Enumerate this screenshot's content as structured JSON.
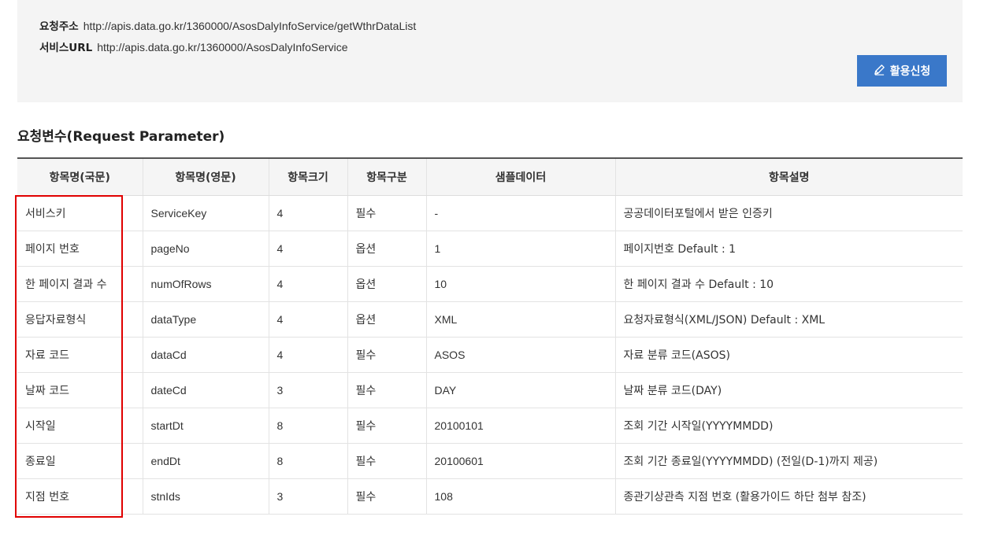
{
  "info": {
    "request_address_label": "요청주소",
    "request_address": "http://apis.data.go.kr/1360000/AsosDalyInfoService/getWthrDataList",
    "service_url_label": "서비스URL",
    "service_url": "http://apis.data.go.kr/1360000/AsosDalyInfoService",
    "apply_button": "활용신청"
  },
  "section_title": "요청변수(Request Parameter)",
  "table": {
    "headers": [
      "항목명(국문)",
      "항목명(영문)",
      "항목크기",
      "항목구분",
      "샘플데이터",
      "항목설명"
    ],
    "rows": [
      [
        "서비스키",
        "ServiceKey",
        "4",
        "필수",
        "-",
        "공공데이터포털에서 받은 인증키"
      ],
      [
        "페이지 번호",
        "pageNo",
        "4",
        "옵션",
        "1",
        "페이지번호 Default : 1"
      ],
      [
        "한 페이지 결과 수",
        "numOfRows",
        "4",
        "옵션",
        "10",
        "한 페이지 결과 수 Default : 10"
      ],
      [
        "응답자료형식",
        "dataType",
        "4",
        "옵션",
        "XML",
        "요청자료형식(XML/JSON) Default : XML"
      ],
      [
        "자료 코드",
        "dataCd",
        "4",
        "필수",
        "ASOS",
        "자료 분류 코드(ASOS)"
      ],
      [
        "날짜 코드",
        "dateCd",
        "3",
        "필수",
        "DAY",
        "날짜 분류 코드(DAY)"
      ],
      [
        "시작일",
        "startDt",
        "8",
        "필수",
        "20100101",
        "조회 기간 시작일(YYYYMMDD)"
      ],
      [
        "종료일",
        "endDt",
        "8",
        "필수",
        "20100601",
        "조회 기간 종료일(YYYYMMDD) (전일(D-1)까지 제공)"
      ],
      [
        "지점 번호",
        "stnIds",
        "3",
        "필수",
        "108",
        "종관기상관측 지점 번호 (활용가이드 하단 첨부 참조)"
      ]
    ]
  },
  "colors": {
    "button_bg": "#3a78c9",
    "highlight": "#e00000",
    "header_bg": "#f5f5f5",
    "info_bg": "#f4f4f4"
  },
  "icons": {
    "apply": "pencil-icon"
  }
}
